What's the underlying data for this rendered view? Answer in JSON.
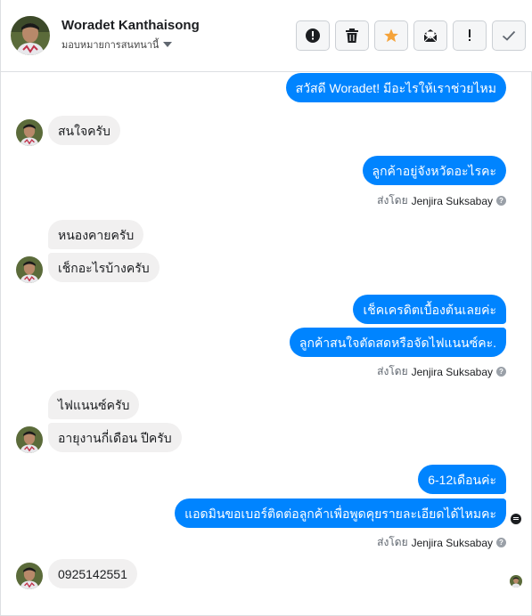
{
  "header": {
    "contact_name": "Woradet Kanthaisong",
    "assign_label": "มอบหมายการสนทนานี้",
    "toolbar": [
      {
        "name": "mark-spam-button",
        "icon": "alert-circle-icon"
      },
      {
        "name": "delete-button",
        "icon": "trash-icon"
      },
      {
        "name": "star-button",
        "icon": "star-icon"
      },
      {
        "name": "mark-unread-button",
        "icon": "envelope-icon"
      },
      {
        "name": "flag-important-button",
        "icon": "exclamation-icon"
      },
      {
        "name": "mark-done-button",
        "icon": "checkmark-icon"
      }
    ]
  },
  "messages": [
    {
      "id": "m1",
      "dir": "out",
      "text": "สวัสดี Woradet! มีอะไรให้เราช่วยไหม"
    },
    {
      "id": "m2",
      "dir": "in",
      "text": "สนใจครับ"
    },
    {
      "id": "m3",
      "dir": "out",
      "text": "ลูกค้าอยู่จังหวัดอะไรคะ"
    },
    {
      "id": "m4",
      "dir": "in",
      "text": "หนองคายครับ"
    },
    {
      "id": "m5",
      "dir": "in",
      "text": "เช็กอะไรบ้างครับ"
    },
    {
      "id": "m6",
      "dir": "out",
      "text": "เช็คเครดิตเบื้องต้นเลยค่ะ"
    },
    {
      "id": "m7",
      "dir": "out",
      "text": "ลูกค้าสนใจตัดสดหรือจัดไฟแนนซ์คะ."
    },
    {
      "id": "m8",
      "dir": "in",
      "text": "ไฟแนนซ์ครับ"
    },
    {
      "id": "m9",
      "dir": "in",
      "text": "อายุงานกี่เดือน ปีครับ"
    },
    {
      "id": "m10",
      "dir": "out",
      "text": "6-12เดือนค่ะ"
    },
    {
      "id": "m11",
      "dir": "out",
      "text": "แอดมินขอเบอร์ติดต่อลูกค้าเพื่อพูดคุยรายละเอียดได้ไหมคะ"
    },
    {
      "id": "m12",
      "dir": "in",
      "text": "0925142551"
    }
  ],
  "sent_by": {
    "prefix": "ส่งโดย",
    "agent": "Jenjira Suksabay",
    "help_glyph": "?"
  },
  "colors": {
    "outgoing_bubble": "#0084ff",
    "incoming_bubble": "#f1f0f0",
    "star": "#f5a33a"
  }
}
